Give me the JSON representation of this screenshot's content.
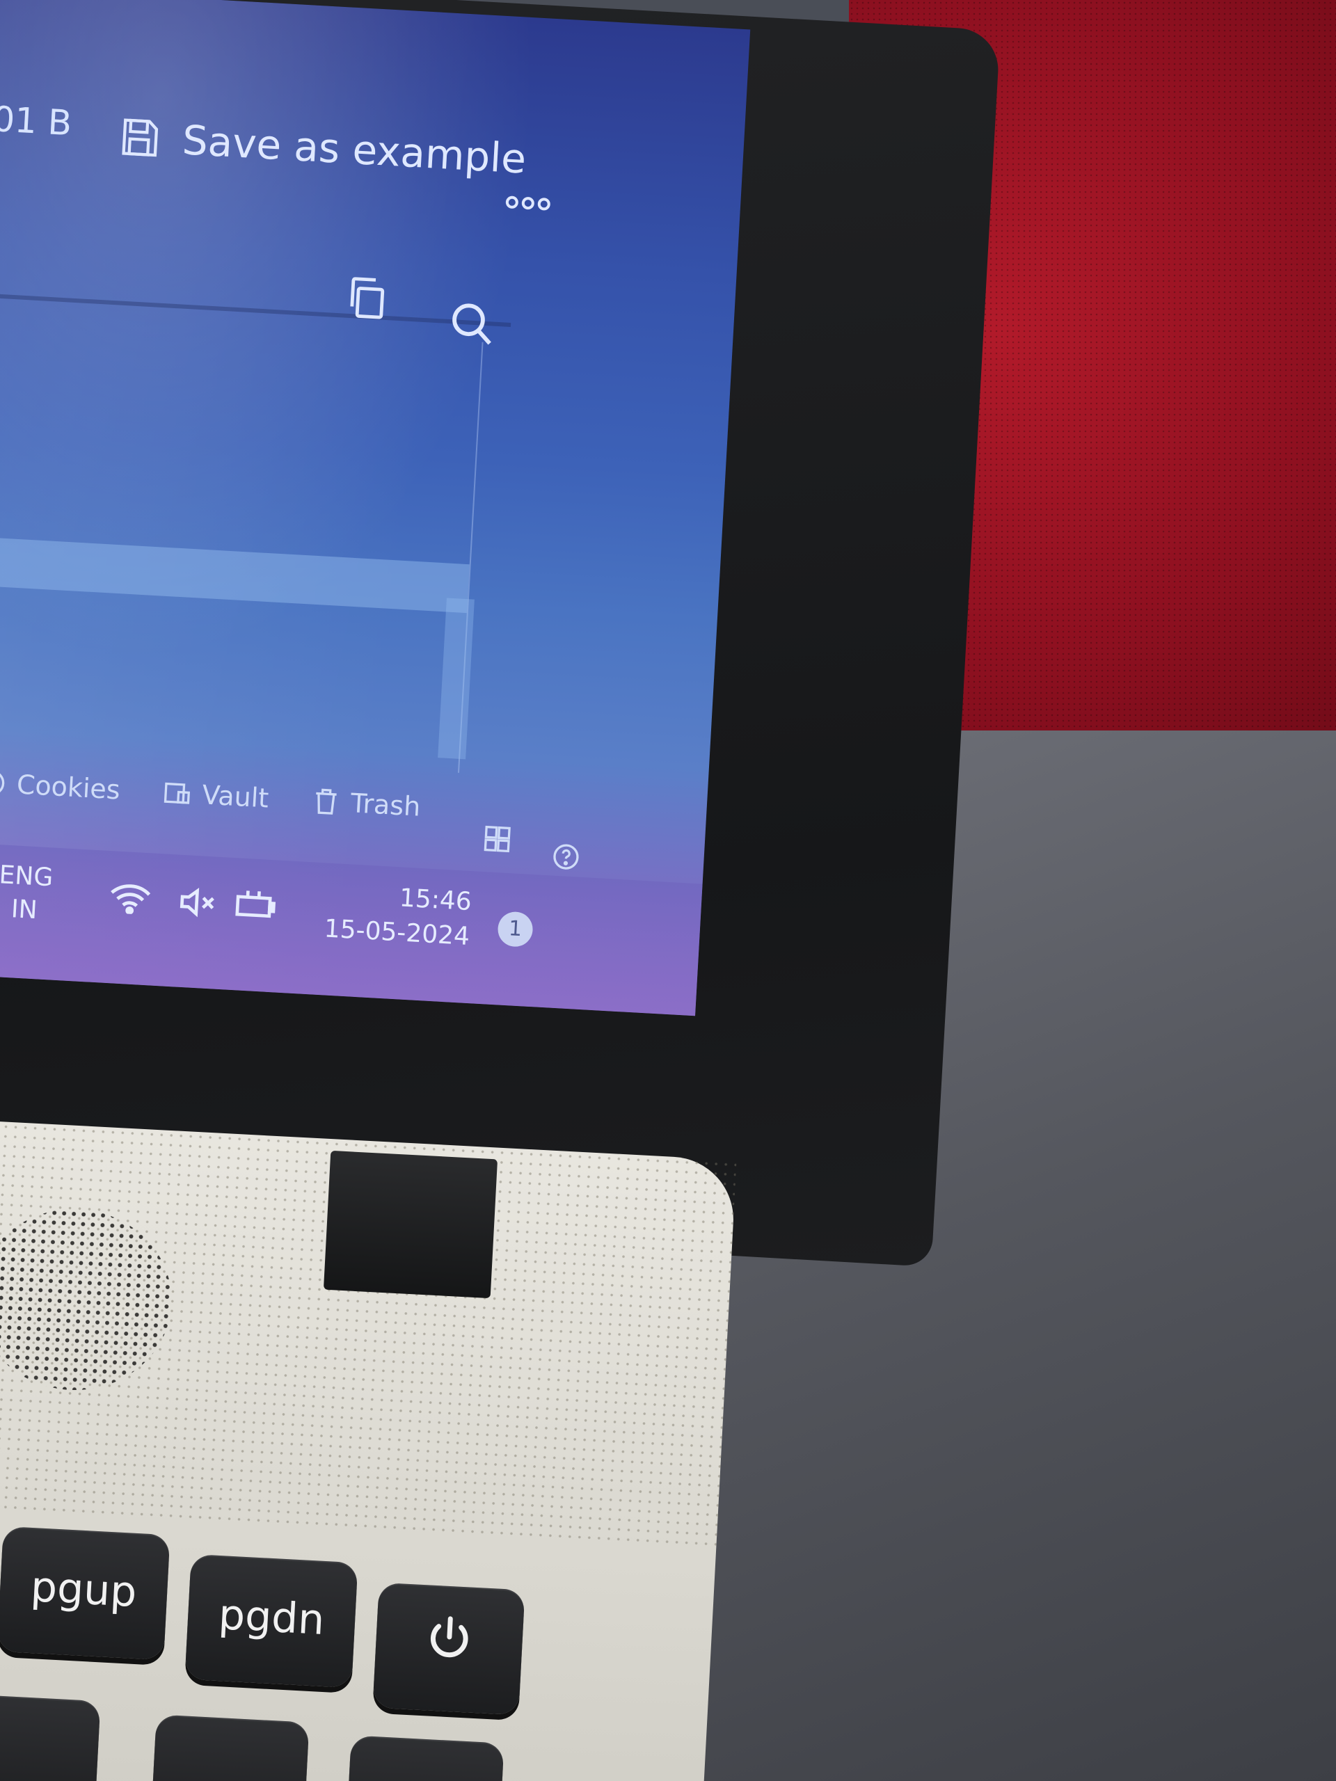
{
  "file_toolbar": {
    "size_text": "01 B",
    "save_label": "Save as example"
  },
  "footer_links": {
    "cookies": "Cookies",
    "vault": "Vault",
    "trash": "Trash"
  },
  "taskbar": {
    "lang_line1": "ENG",
    "lang_line2": "IN",
    "time": "15:46",
    "date": "15-05-2024",
    "notification_count": "1"
  },
  "keyboard": {
    "pgup": "pgup",
    "pgdn": "pgdn"
  },
  "colors": {
    "screen_blue": "#3d62b8",
    "taskbar_purple": "#8a6ec6",
    "sofa_red": "#8e1020"
  }
}
